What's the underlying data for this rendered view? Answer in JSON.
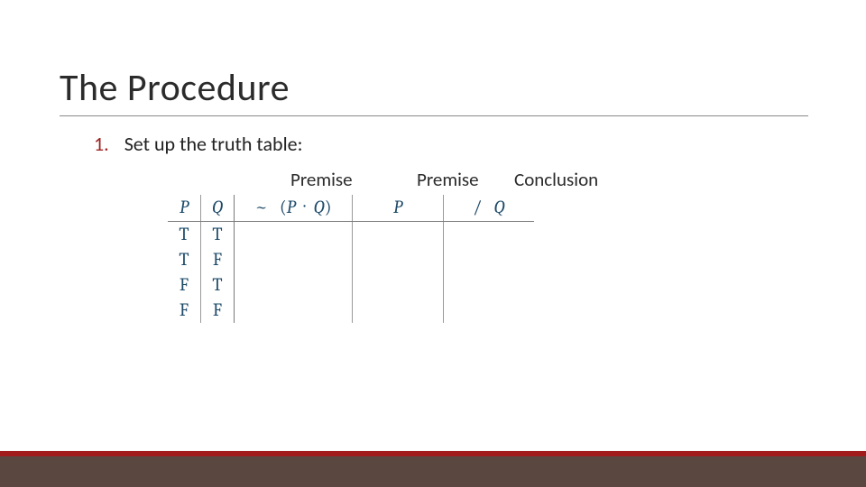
{
  "title": "The Procedure",
  "step": {
    "num": "1.",
    "text": "Set up the truth table:"
  },
  "labels": {
    "premise": "Premise",
    "conclusion": "Conclusion"
  },
  "table": {
    "headers": {
      "p": "P",
      "q": "Q",
      "c1_neg": "~",
      "c1_open": "(",
      "c1_p": "P",
      "c1_dot": "·",
      "c1_q": "Q",
      "c1_close": ")",
      "c2_p": "P",
      "c3_slash": "/",
      "c3_q": "Q"
    },
    "rows": [
      {
        "p": "T",
        "q": "T"
      },
      {
        "p": "T",
        "q": "F"
      },
      {
        "p": "F",
        "q": "T"
      },
      {
        "p": "F",
        "q": "F"
      }
    ]
  },
  "colors": {
    "accent_red": "#a31c1c",
    "footer_brown": "#5a4840",
    "table_text": "#1e4b6a"
  }
}
